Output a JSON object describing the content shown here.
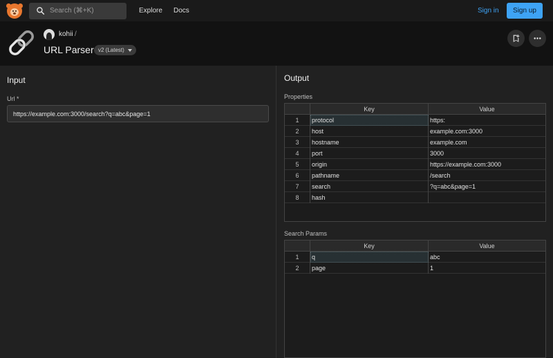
{
  "nav": {
    "search_placeholder": "Search (⌘+K)",
    "explore": "Explore",
    "docs": "Docs",
    "sign_in": "Sign in",
    "sign_up": "Sign up"
  },
  "tool": {
    "owner": "kohii",
    "separator": "/",
    "title": "URL Parser",
    "version": "v2 (Latest)"
  },
  "input": {
    "heading": "Input",
    "url_label": "Url *",
    "url_value": "https://example.com:3000/search?q=abc&page=1"
  },
  "output": {
    "heading": "Output",
    "properties": {
      "label": "Properties",
      "headers": [
        "Key",
        "Value"
      ],
      "rows": [
        {
          "n": "1",
          "key": "protocol",
          "value": "https:"
        },
        {
          "n": "2",
          "key": "host",
          "value": "example.com:3000"
        },
        {
          "n": "3",
          "key": "hostname",
          "value": "example.com"
        },
        {
          "n": "4",
          "key": "port",
          "value": "3000"
        },
        {
          "n": "5",
          "key": "origin",
          "value": "https://example.com:3000"
        },
        {
          "n": "6",
          "key": "pathname",
          "value": "/search"
        },
        {
          "n": "7",
          "key": "search",
          "value": "?q=abc&page=1"
        },
        {
          "n": "8",
          "key": "hash",
          "value": ""
        }
      ]
    },
    "search_params": {
      "label": "Search Params",
      "headers": [
        "Key",
        "Value"
      ],
      "rows": [
        {
          "n": "1",
          "key": "q",
          "value": "abc"
        },
        {
          "n": "2",
          "key": "page",
          "value": "1"
        }
      ]
    }
  },
  "icons": {
    "logo": "bear-logo-icon",
    "search": "search-icon",
    "tool": "link-chain-icon",
    "bookmark": "bookmark-add-icon",
    "more": "more-horizontal-icon"
  },
  "colors": {
    "accent": "#3ea3f5",
    "brand": "#e8772e"
  }
}
